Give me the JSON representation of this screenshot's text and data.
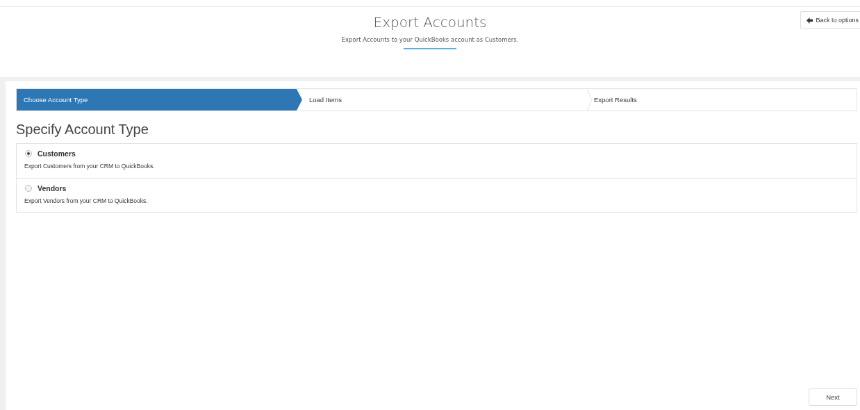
{
  "header": {
    "title": "Export Accounts",
    "subtitle": "Export Accounts to your QuickBooks account as Customers.",
    "back_button": "Back to options"
  },
  "steps": [
    {
      "label": "Choose Account Type",
      "selected": true
    },
    {
      "label": "Load Items",
      "selected": false
    },
    {
      "label": "Export Results",
      "selected": false
    }
  ],
  "section_title": "Specify Account Type",
  "options": [
    {
      "label": "Customers",
      "description": "Export Customers from your CRM to QuickBooks.",
      "selected": true
    },
    {
      "label": "Vendors",
      "description": "Export Vendors from your CRM to QuickBooks.",
      "selected": false
    }
  ],
  "next_button": "Next"
}
